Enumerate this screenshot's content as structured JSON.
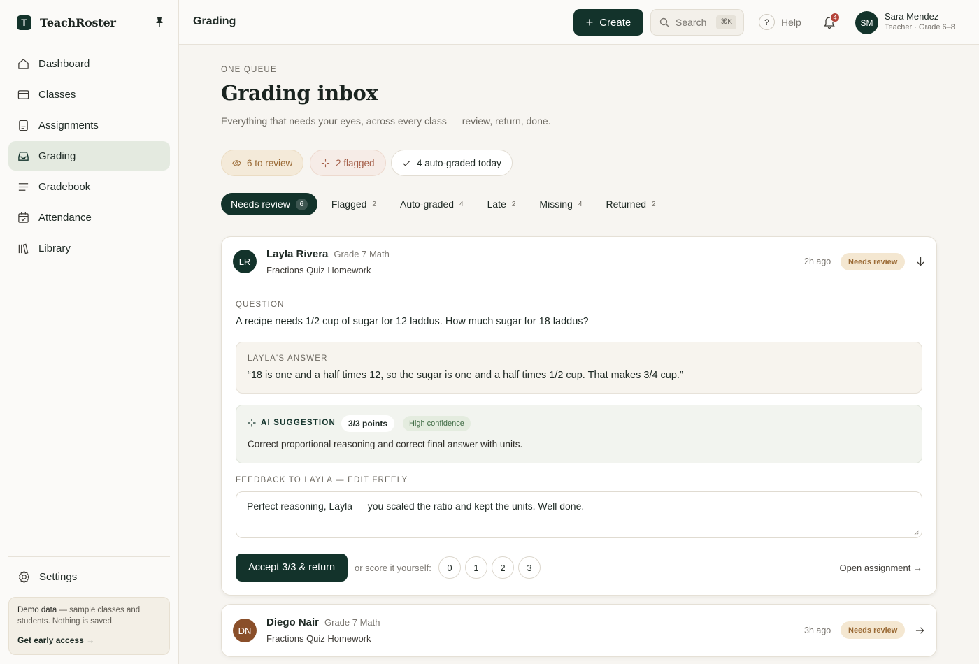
{
  "brand": {
    "name": "TeachRoster",
    "logo_letter": "T"
  },
  "sidebar": {
    "items": [
      {
        "label": "Dashboard",
        "icon": "home-icon"
      },
      {
        "label": "Classes",
        "icon": "classes-icon"
      },
      {
        "label": "Assignments",
        "icon": "assignments-icon"
      },
      {
        "label": "Grading",
        "icon": "inbox-icon",
        "active": true
      },
      {
        "label": "Gradebook",
        "icon": "list-icon"
      },
      {
        "label": "Attendance",
        "icon": "calendar-icon"
      },
      {
        "label": "Library",
        "icon": "library-icon"
      }
    ],
    "settings_label": "Settings",
    "demo": {
      "bold": "Demo data",
      "text": " — sample classes and students. Nothing is saved.",
      "link": "Get early access →"
    }
  },
  "header": {
    "title": "Grading",
    "create_label": "Create",
    "search_placeholder": "Search",
    "search_shortcut": "⌘K",
    "help_label": "Help",
    "notification_count": "4",
    "user": {
      "initials": "SM",
      "name": "Sara Mendez",
      "role": "Teacher · Grade 6–8"
    }
  },
  "main": {
    "eyebrow": "ONE QUEUE",
    "title": "Grading inbox",
    "subtitle": "Everything that needs your eyes, across every class — review, return, done.",
    "summary": {
      "review": "6 to review",
      "flagged": "2 flagged",
      "auto": "4 auto-graded today"
    },
    "tabs": [
      {
        "label": "Needs review",
        "count": "6",
        "active": true
      },
      {
        "label": "Flagged",
        "count": "2"
      },
      {
        "label": "Auto-graded",
        "count": "4"
      },
      {
        "label": "Late",
        "count": "2"
      },
      {
        "label": "Missing",
        "count": "4"
      },
      {
        "label": "Returned",
        "count": "2"
      }
    ]
  },
  "submissions": [
    {
      "initials": "LR",
      "avatar_color": "#13332b",
      "name": "Layla Rivera",
      "class": "Grade 7 Math",
      "assignment": "Fractions Quiz Homework",
      "time": "2h ago",
      "status": "Needs review",
      "question_label": "QUESTION",
      "question": "A recipe needs 1/2 cup of sugar for 12 laddus. How much sugar for 18 laddus?",
      "answer_label": "LAYLA'S ANSWER",
      "answer": "“18 is one and a half times 12, so the sugar is one and a half times 1/2 cup. That makes 3/4 cup.”",
      "ai_label": "AI SUGGESTION",
      "ai_points": "3/3 points",
      "ai_confidence": "High confidence",
      "ai_text": "Correct proportional reasoning and correct final answer with units.",
      "feedback_label": "FEEDBACK TO LAYLA — EDIT FREELY",
      "feedback": "Perfect reasoning, Layla — you scaled the ratio and kept the units. Well done.",
      "accept_label": "Accept 3/3 & return",
      "score_label": "or score it yourself:",
      "scores": [
        "0",
        "1",
        "2",
        "3"
      ],
      "open_label": "Open assignment →"
    },
    {
      "initials": "DN",
      "avatar_color": "#8a4f2a",
      "name": "Diego Nair",
      "class": "Grade 7 Math",
      "assignment": "Fractions Quiz Homework",
      "time": "3h ago",
      "status": "Needs review"
    }
  ]
}
